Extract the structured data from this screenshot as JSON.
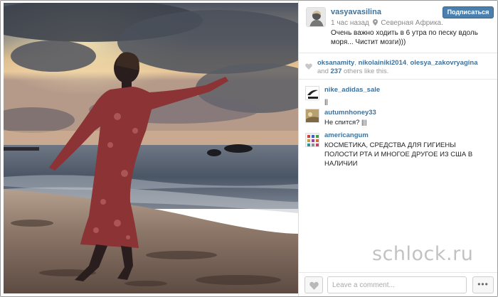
{
  "post": {
    "username": "vasyavasilina",
    "follow_label": "Подписаться",
    "time": "1 час назад",
    "location": "Северная Африка.",
    "caption": "Очень важно ходить в 6 утра по песку вдоль моря... Чистит мозги)))"
  },
  "likes": {
    "users": [
      "oksanamity",
      "nikolainiki2014",
      "olesya_zakovryagina"
    ],
    "sep": ",",
    "and": "and",
    "others_count": "237",
    "others_suffix": "others like this."
  },
  "comments": [
    {
      "user": "nike_adidas_sale",
      "text": "||"
    },
    {
      "user": "autumnhoney33",
      "text": "Не спится? |||"
    },
    {
      "user": "americangum",
      "text": "КОСМЕТИКА, СРЕДСТВА ДЛЯ ГИГИЕНЫ ПОЛОСТИ РТА И МНОГОЕ ДРУГОЕ ИЗ США В НАЛИЧИИ"
    }
  ],
  "footer": {
    "comment_placeholder": "Leave a comment...",
    "more_label": "•••"
  },
  "watermark": "schlock.ru",
  "colors": {
    "link": "#3f729b",
    "follow_button": "#4a7fae"
  },
  "icons": {
    "like": "heart-icon",
    "location": "location-pin-icon",
    "more": "ellipsis-icon"
  }
}
